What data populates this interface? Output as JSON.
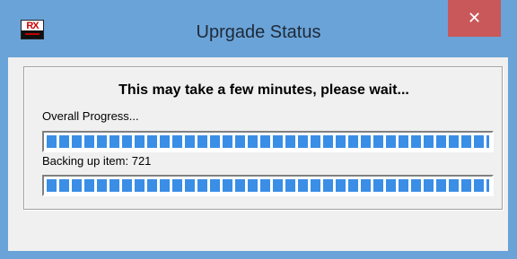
{
  "window": {
    "title": "Uprgade Status",
    "close_label": "✕",
    "icon_text": "RX"
  },
  "dialog": {
    "heading": "This may take a few minutes, please wait...",
    "overall_label": "Overall Progress...",
    "overall_progress_percent": 100,
    "item_label": "Backing up item: 721",
    "item_progress_percent": 100
  },
  "colors": {
    "titlebar": "#6aa3d8",
    "close_button": "#c9585a",
    "progress_fill": "#3a8ee6"
  }
}
